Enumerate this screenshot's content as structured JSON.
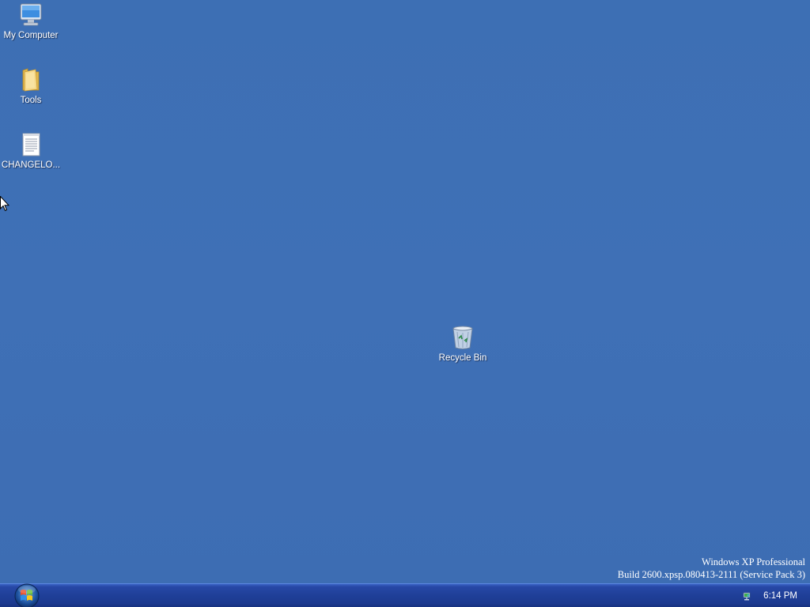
{
  "desktop": {
    "background_color": "#3d6fb4",
    "icons": [
      {
        "label": "My Computer",
        "icon": "computer-icon"
      },
      {
        "label": "Tools",
        "icon": "folder-icon"
      },
      {
        "label": "CHANGELO...",
        "icon": "text-document-icon"
      },
      {
        "label": "Recycle Bin",
        "icon": "recycle-bin-icon"
      }
    ],
    "watermark": {
      "line1": "Windows XP Professional",
      "line2": "Build 2600.xpsp.080413-2111 (Service Pack 3)"
    }
  },
  "taskbar": {
    "start_icon": "windows-logo-icon",
    "tray_icon": "network-icon",
    "clock": "6:14 PM",
    "color": "#1f3f98"
  }
}
